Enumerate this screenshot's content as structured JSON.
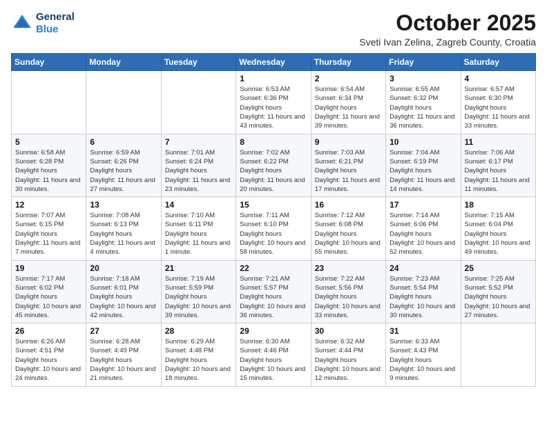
{
  "header": {
    "logo_line1": "General",
    "logo_line2": "Blue",
    "month_title": "October 2025",
    "location": "Sveti Ivan Zelina, Zagreb County, Croatia"
  },
  "weekdays": [
    "Sunday",
    "Monday",
    "Tuesday",
    "Wednesday",
    "Thursday",
    "Friday",
    "Saturday"
  ],
  "weeks": [
    [
      null,
      null,
      null,
      {
        "day": "1",
        "sunrise": "6:53 AM",
        "sunset": "6:36 PM",
        "daylight": "11 hours and 43 minutes."
      },
      {
        "day": "2",
        "sunrise": "6:54 AM",
        "sunset": "6:34 PM",
        "daylight": "11 hours and 39 minutes."
      },
      {
        "day": "3",
        "sunrise": "6:55 AM",
        "sunset": "6:32 PM",
        "daylight": "11 hours and 36 minutes."
      },
      {
        "day": "4",
        "sunrise": "6:57 AM",
        "sunset": "6:30 PM",
        "daylight": "11 hours and 33 minutes."
      }
    ],
    [
      {
        "day": "5",
        "sunrise": "6:58 AM",
        "sunset": "6:28 PM",
        "daylight": "11 hours and 30 minutes."
      },
      {
        "day": "6",
        "sunrise": "6:59 AM",
        "sunset": "6:26 PM",
        "daylight": "11 hours and 27 minutes."
      },
      {
        "day": "7",
        "sunrise": "7:01 AM",
        "sunset": "6:24 PM",
        "daylight": "11 hours and 23 minutes."
      },
      {
        "day": "8",
        "sunrise": "7:02 AM",
        "sunset": "6:22 PM",
        "daylight": "11 hours and 20 minutes."
      },
      {
        "day": "9",
        "sunrise": "7:03 AM",
        "sunset": "6:21 PM",
        "daylight": "11 hours and 17 minutes."
      },
      {
        "day": "10",
        "sunrise": "7:04 AM",
        "sunset": "6:19 PM",
        "daylight": "11 hours and 14 minutes."
      },
      {
        "day": "11",
        "sunrise": "7:06 AM",
        "sunset": "6:17 PM",
        "daylight": "11 hours and 11 minutes."
      }
    ],
    [
      {
        "day": "12",
        "sunrise": "7:07 AM",
        "sunset": "6:15 PM",
        "daylight": "11 hours and 7 minutes."
      },
      {
        "day": "13",
        "sunrise": "7:08 AM",
        "sunset": "6:13 PM",
        "daylight": "11 hours and 4 minutes."
      },
      {
        "day": "14",
        "sunrise": "7:10 AM",
        "sunset": "6:11 PM",
        "daylight": "11 hours and 1 minute."
      },
      {
        "day": "15",
        "sunrise": "7:11 AM",
        "sunset": "6:10 PM",
        "daylight": "10 hours and 58 minutes."
      },
      {
        "day": "16",
        "sunrise": "7:12 AM",
        "sunset": "6:08 PM",
        "daylight": "10 hours and 55 minutes."
      },
      {
        "day": "17",
        "sunrise": "7:14 AM",
        "sunset": "6:06 PM",
        "daylight": "10 hours and 52 minutes."
      },
      {
        "day": "18",
        "sunrise": "7:15 AM",
        "sunset": "6:04 PM",
        "daylight": "10 hours and 49 minutes."
      }
    ],
    [
      {
        "day": "19",
        "sunrise": "7:17 AM",
        "sunset": "6:02 PM",
        "daylight": "10 hours and 45 minutes."
      },
      {
        "day": "20",
        "sunrise": "7:18 AM",
        "sunset": "6:01 PM",
        "daylight": "10 hours and 42 minutes."
      },
      {
        "day": "21",
        "sunrise": "7:19 AM",
        "sunset": "5:59 PM",
        "daylight": "10 hours and 39 minutes."
      },
      {
        "day": "22",
        "sunrise": "7:21 AM",
        "sunset": "5:57 PM",
        "daylight": "10 hours and 36 minutes."
      },
      {
        "day": "23",
        "sunrise": "7:22 AM",
        "sunset": "5:56 PM",
        "daylight": "10 hours and 33 minutes."
      },
      {
        "day": "24",
        "sunrise": "7:23 AM",
        "sunset": "5:54 PM",
        "daylight": "10 hours and 30 minutes."
      },
      {
        "day": "25",
        "sunrise": "7:25 AM",
        "sunset": "5:52 PM",
        "daylight": "10 hours and 27 minutes."
      }
    ],
    [
      {
        "day": "26",
        "sunrise": "6:26 AM",
        "sunset": "4:51 PM",
        "daylight": "10 hours and 24 minutes."
      },
      {
        "day": "27",
        "sunrise": "6:28 AM",
        "sunset": "4:49 PM",
        "daylight": "10 hours and 21 minutes."
      },
      {
        "day": "28",
        "sunrise": "6:29 AM",
        "sunset": "4:48 PM",
        "daylight": "10 hours and 18 minutes."
      },
      {
        "day": "29",
        "sunrise": "6:30 AM",
        "sunset": "4:46 PM",
        "daylight": "10 hours and 15 minutes."
      },
      {
        "day": "30",
        "sunrise": "6:32 AM",
        "sunset": "4:44 PM",
        "daylight": "10 hours and 12 minutes."
      },
      {
        "day": "31",
        "sunrise": "6:33 AM",
        "sunset": "4:43 PM",
        "daylight": "10 hours and 9 minutes."
      },
      null
    ]
  ]
}
